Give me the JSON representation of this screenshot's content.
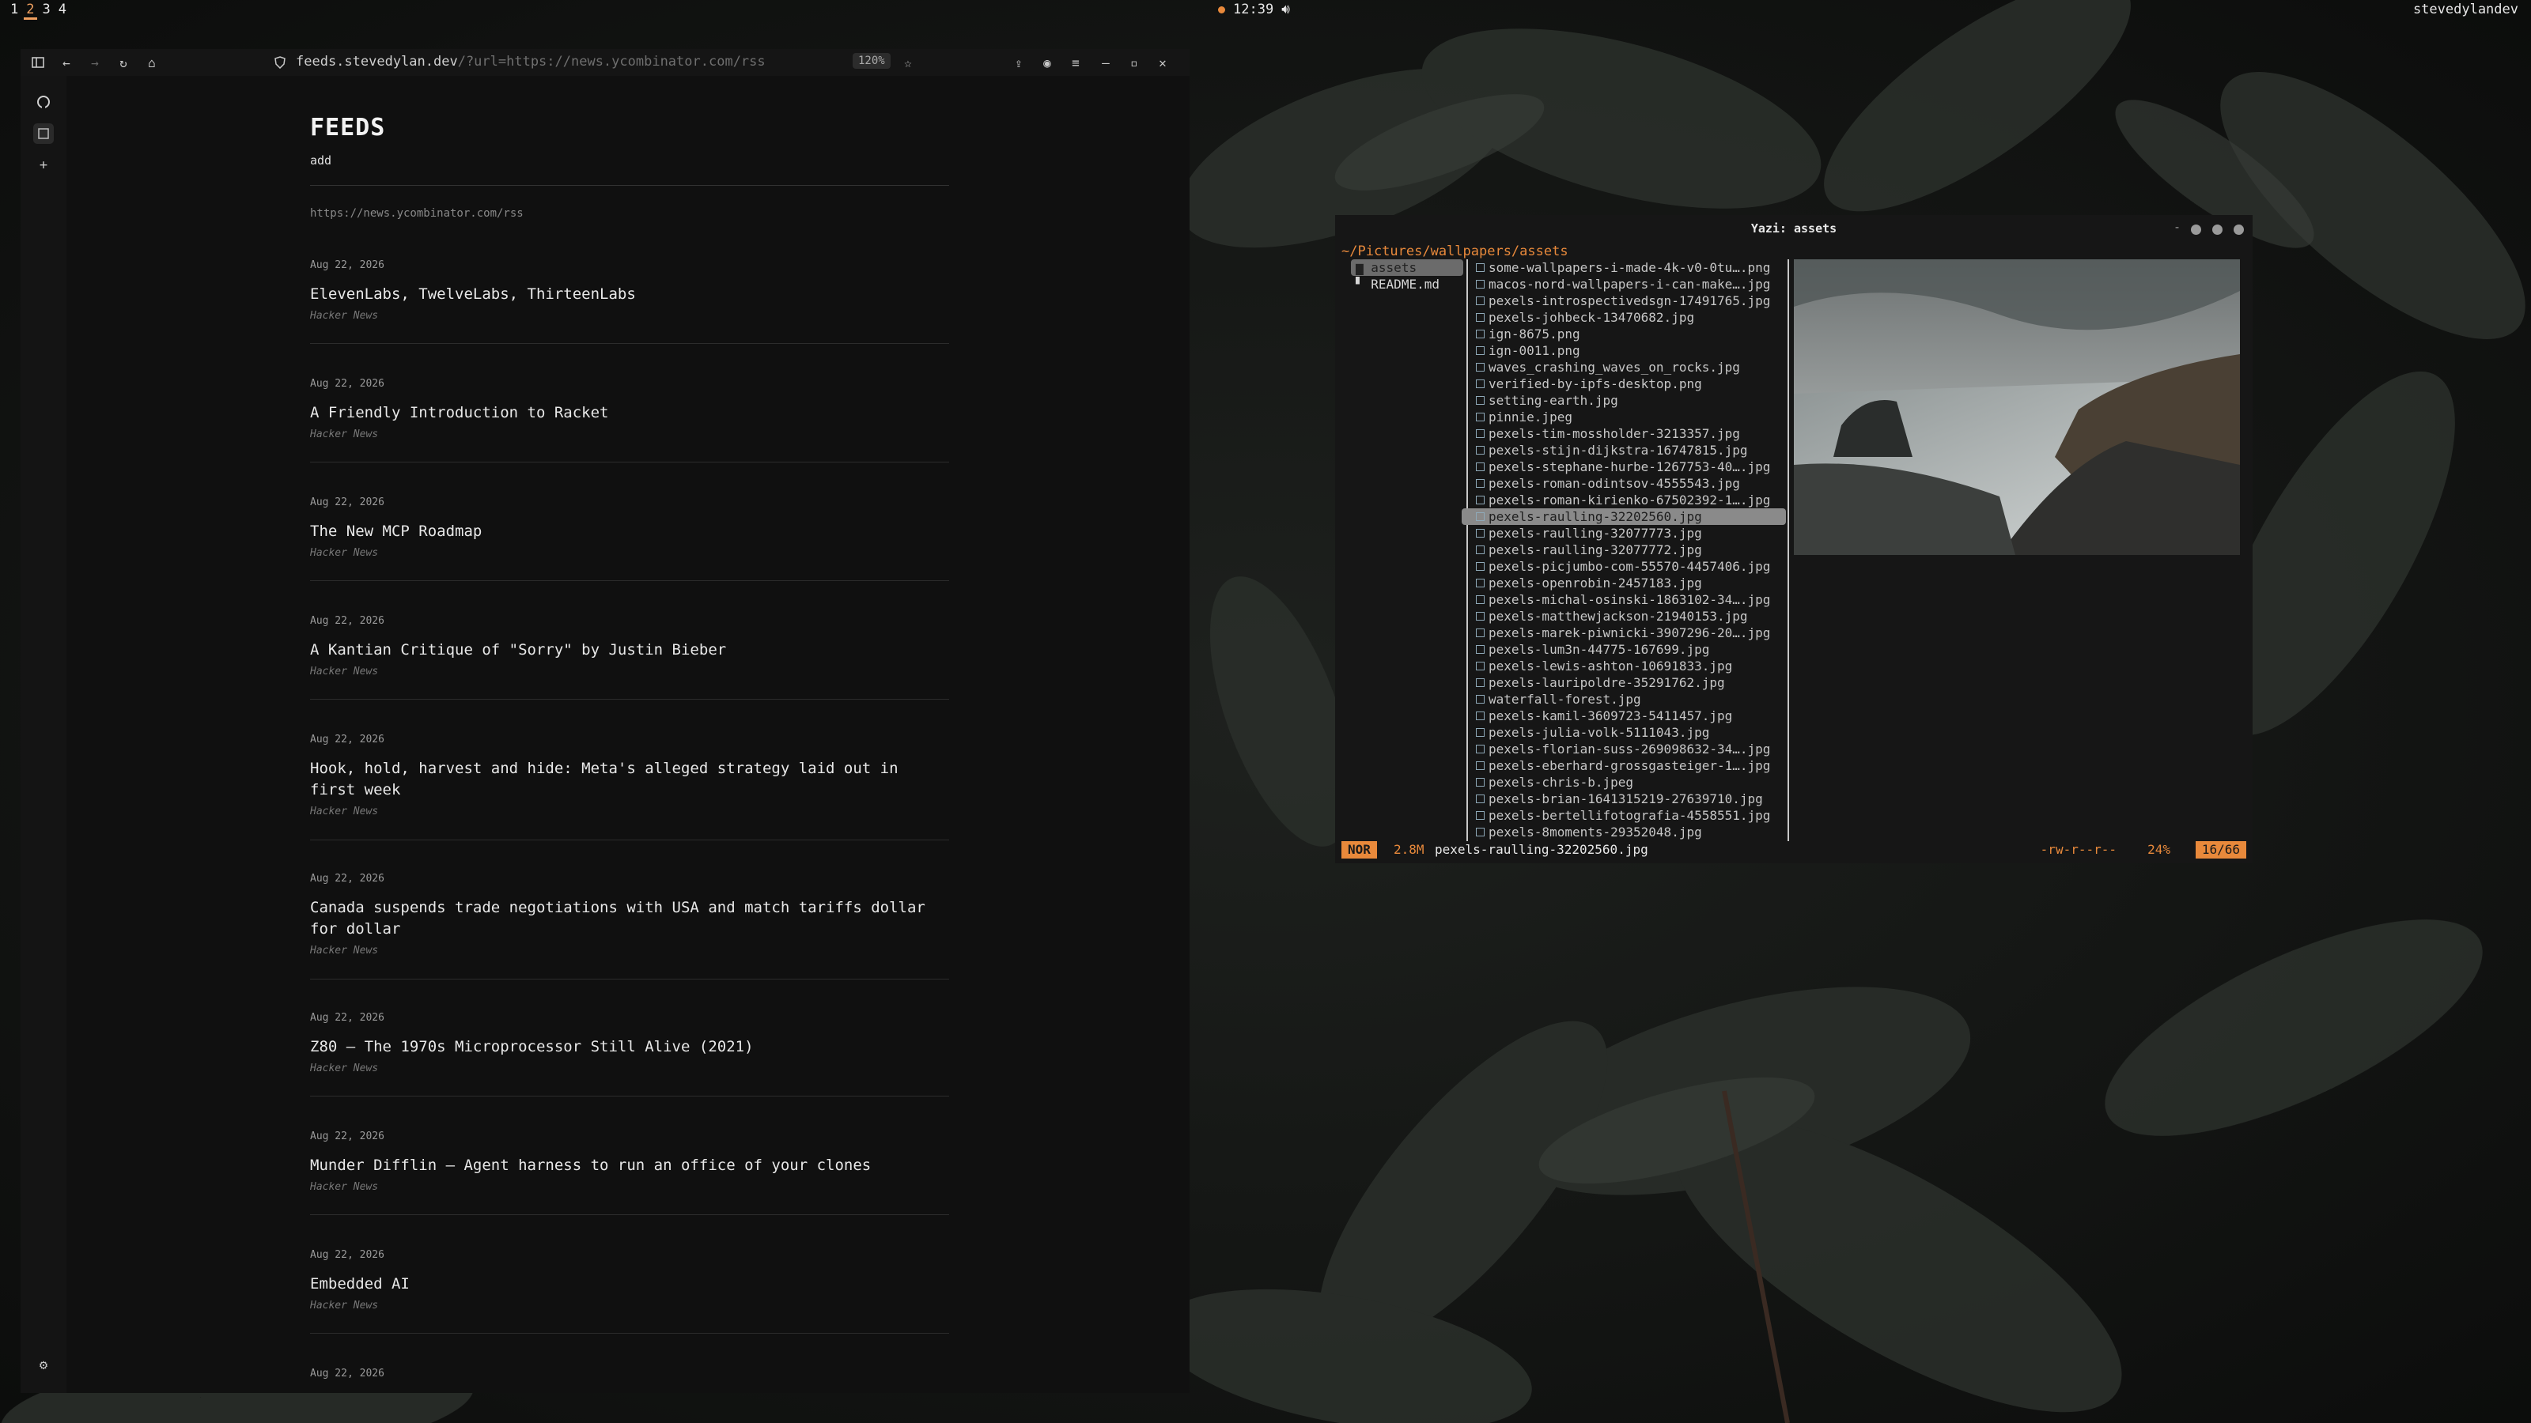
{
  "topbar": {
    "workspaces": [
      "1",
      "2",
      "3",
      "4"
    ],
    "active_workspace": "2",
    "clock": "12:39",
    "username": "stevedylandev"
  },
  "browser": {
    "url_host": "feeds.stevedylan.dev",
    "url_path": "/?url=https://news.ycombinator.com/rss",
    "zoom": "120%",
    "page": {
      "title": "FEEDS",
      "add_label": "add",
      "feed_url": "https://news.ycombinator.com/rss",
      "items": [
        {
          "date": "Aug 22, 2026",
          "title": "ElevenLabs, TwelveLabs, ThirteenLabs",
          "source": "Hacker News"
        },
        {
          "date": "Aug 22, 2026",
          "title": "A Friendly Introduction to Racket",
          "source": "Hacker News"
        },
        {
          "date": "Aug 22, 2026",
          "title": "The New MCP Roadmap",
          "source": "Hacker News"
        },
        {
          "date": "Aug 22, 2026",
          "title": "A Kantian Critique of \"Sorry\" by Justin Bieber",
          "source": "Hacker News"
        },
        {
          "date": "Aug 22, 2026",
          "title": "Hook, hold, harvest and hide: Meta's alleged strategy laid out in first week",
          "source": "Hacker News"
        },
        {
          "date": "Aug 22, 2026",
          "title": "Canada suspends trade negotiations with USA and match tariffs dollar for dollar",
          "source": "Hacker News"
        },
        {
          "date": "Aug 22, 2026",
          "title": "Z80 – The 1970s Microprocessor Still Alive (2021)",
          "source": "Hacker News"
        },
        {
          "date": "Aug 22, 2026",
          "title": "Munder Difflin – Agent harness to run an office of your clones",
          "source": "Hacker News"
        },
        {
          "date": "Aug 22, 2026",
          "title": "Embedded AI",
          "source": "Hacker News"
        },
        {
          "date": "Aug 22, 2026",
          "title": "",
          "source": ""
        }
      ]
    }
  },
  "terminal": {
    "title": "Yazi: assets",
    "path": "~/Pictures/wallpapers/assets",
    "parent_entries": [
      "assets",
      "README.md"
    ],
    "files": [
      "some-wallpapers-i-made-4k-v0-0tu….png",
      "macos-nord-wallpapers-i-can-make….jpg",
      "pexels-introspectivedsgn-17491765.jpg",
      "pexels-johbeck-13470682.jpg",
      "ign-8675.png",
      "ign-0011.png",
      "waves_crashing_waves_on_rocks.jpg",
      "verified-by-ipfs-desktop.png",
      "setting-earth.jpg",
      "pinnie.jpeg",
      "pexels-tim-mossholder-3213357.jpg",
      "pexels-stijn-dijkstra-16747815.jpg",
      "pexels-stephane-hurbe-1267753-40….jpg",
      "pexels-roman-odintsov-4555543.jpg",
      "pexels-roman-kirienko-67502392-1….jpg",
      "pexels-raulling-32202560.jpg",
      "pexels-raulling-32077773.jpg",
      "pexels-raulling-32077772.jpg",
      "pexels-picjumbo-com-55570-4457406.jpg",
      "pexels-openrobin-2457183.jpg",
      "pexels-michal-osinski-1863102-34….jpg",
      "pexels-matthewjackson-21940153.jpg",
      "pexels-marek-piwnicki-3907296-20….jpg",
      "pexels-lum3n-44775-167699.jpg",
      "pexels-lewis-ashton-10691833.jpg",
      "pexels-lauripoldre-35291762.jpg",
      "waterfall-forest.jpg",
      "pexels-kamil-3609723-5411457.jpg",
      "pexels-julia-volk-5111043.jpg",
      "pexels-florian-suss-269098632-34….jpg",
      "pexels-eberhard-grossgasteiger-1….jpg",
      "pexels-chris-b.jpeg",
      "pexels-brian-1641315219-27639710.jpg",
      "pexels-bertellifotografia-4558551.jpg",
      "pexels-8moments-29352048.jpg"
    ],
    "selected_index": 15,
    "status": {
      "mode": "NOR",
      "size": "2.8M",
      "file": "pexels-raulling-32202560.jpg",
      "perms": "-rw-r--r--",
      "percent": "24%",
      "position": "16/66"
    }
  }
}
